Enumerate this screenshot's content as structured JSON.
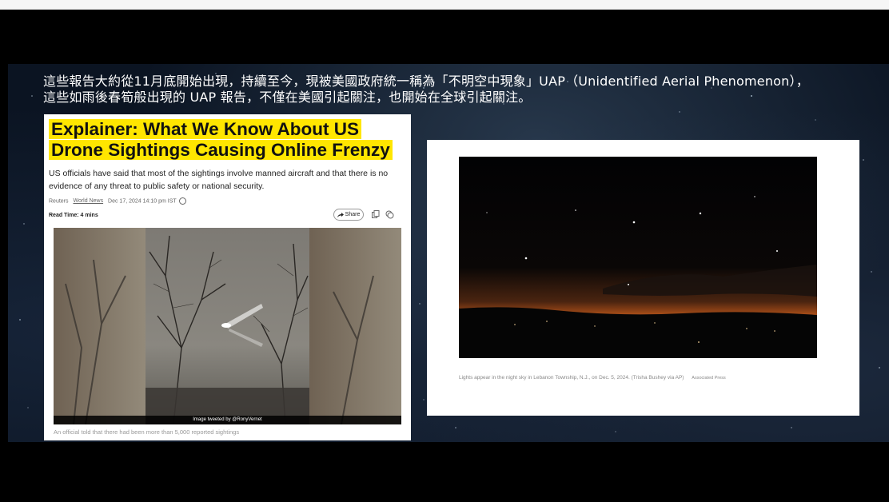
{
  "caption": {
    "line1": "這些報告大約從11月底開始出現，持續至今，現被美國政府統一稱為「不明空中現象」UAP（Unidentified Aerial Phenomenon），",
    "line2": "這些如雨後春筍般出現的 UAP 報告，不僅在美國引起關注，也開始在全球引起關注。"
  },
  "article": {
    "headline_line1": "Explainer: What We Know About US",
    "headline_line2": "Drone Sightings Causing Online Frenzy",
    "deck": "US officials have said that most of the sightings involve manned aircraft and that there is no evidence of any threat to public safety or national security.",
    "source": "Reuters",
    "section": "World News",
    "date": "Dec 17, 2024 14:10 pm IST",
    "read_time": "Read Time: 4 mins",
    "share_label": "Share",
    "image_credit": "Image tweeted by @RonyVernet",
    "image_caption": "An official told that there had been more than 5,000 reported sightings",
    "highlight_color": "#ffe600"
  },
  "photo_card": {
    "caption": "Lights appear in the night sky in Lebanon Township, N.J., on Dec. 5, 2024. (Trisha Bushey via AP)",
    "agency": "Associated Press"
  }
}
